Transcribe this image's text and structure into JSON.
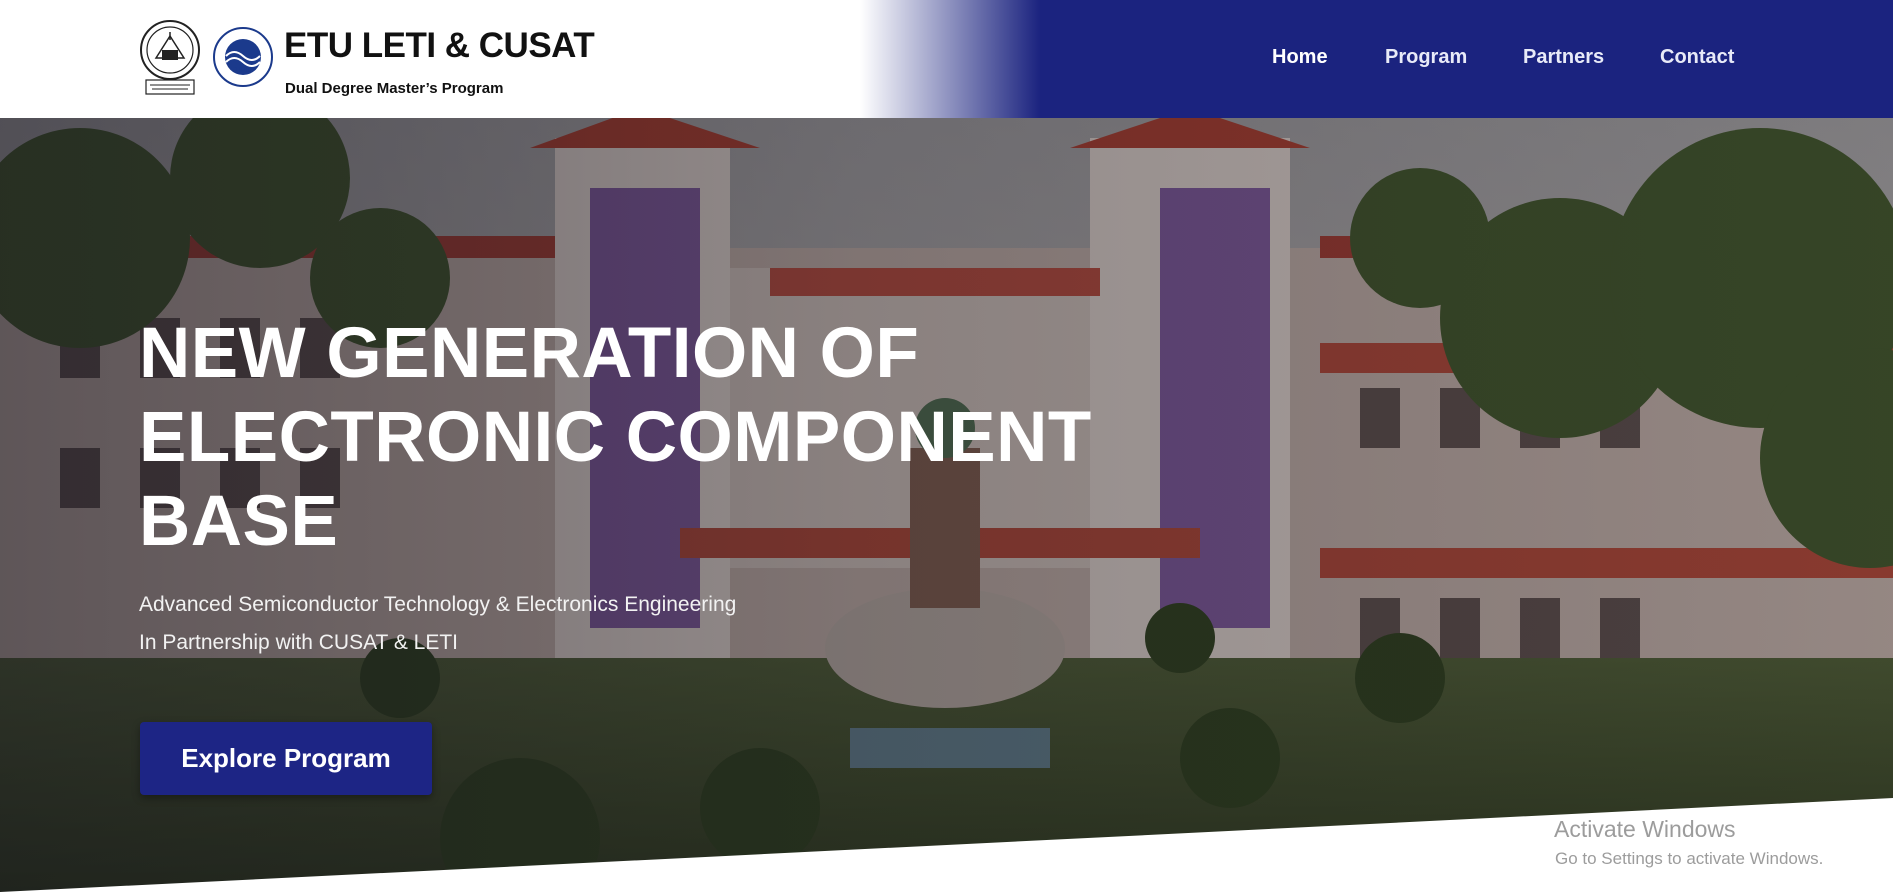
{
  "header": {
    "brand_title": "ETU LETI & CUSAT",
    "brand_subtitle": "Dual Degree Master’s Program",
    "logo_cusat_icon": "cusat-seal-icon",
    "logo_leti_icon": "leti-seal-icon",
    "leti_logo_year": "1886"
  },
  "nav": {
    "items": [
      {
        "label": "Home",
        "active": true
      },
      {
        "label": "Program",
        "active": false
      },
      {
        "label": "Partners",
        "active": false
      },
      {
        "label": "Contact",
        "active": false
      }
    ]
  },
  "hero": {
    "title_lines": [
      "NEW GENERATION OF",
      "ELECTRONIC COMPONENT",
      "BASE"
    ],
    "subtitle_1": "Advanced Semiconductor Technology & Electronics Engineering",
    "subtitle_2": "In Partnership with CUSAT & LETI",
    "cta_label": "Explore Program"
  },
  "watermark": {
    "title": "Activate Windows",
    "subtitle": "Go to Settings to activate Windows."
  },
  "colors": {
    "brand_navy": "#1b237f",
    "cta_navy": "#1d2585",
    "text_dark": "#111111",
    "text_light": "#ffffff"
  }
}
